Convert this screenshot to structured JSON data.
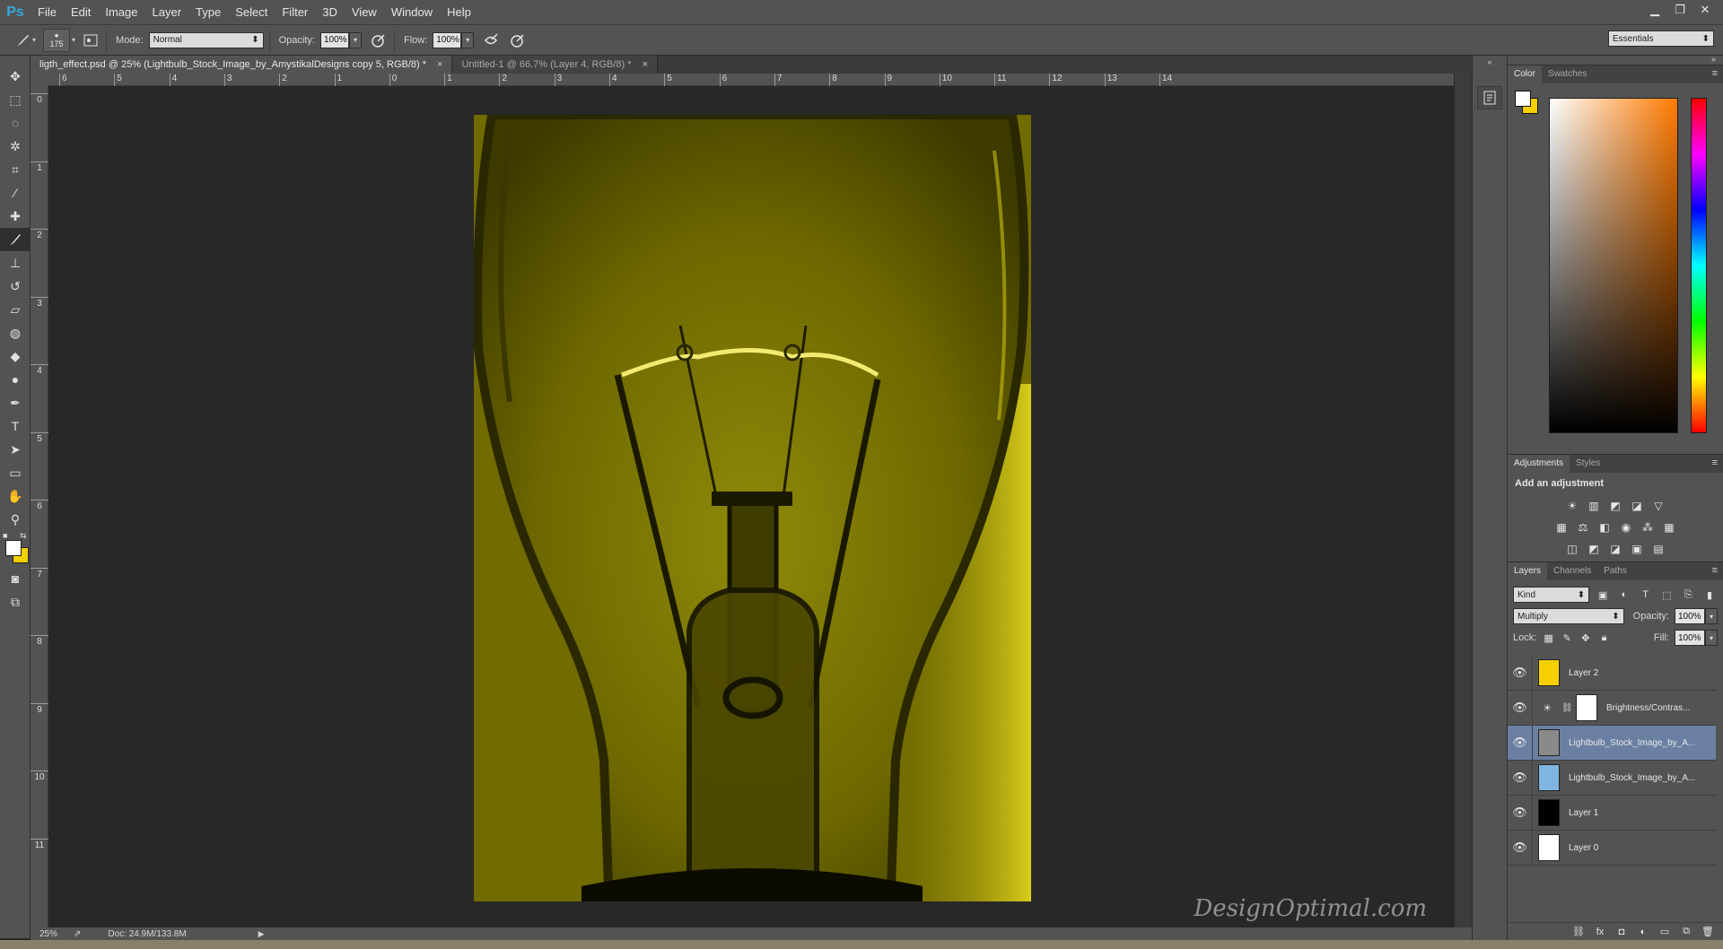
{
  "app": {
    "logo": "Ps"
  },
  "menu": [
    "File",
    "Edit",
    "Image",
    "Layer",
    "Type",
    "Select",
    "Filter",
    "3D",
    "View",
    "Window",
    "Help"
  ],
  "window_controls": {
    "minimize": "▁",
    "restore": "❐",
    "close": "✕"
  },
  "options": {
    "brush_size": "175",
    "mode_label": "Mode:",
    "mode_value": "Normal",
    "opacity_label": "Opacity:",
    "opacity_value": "100%",
    "flow_label": "Flow:",
    "flow_value": "100%",
    "workspace": "Essentials"
  },
  "tabs": [
    {
      "label": "ligth_effect.psd @ 25% (Lightbulb_Stock_Image_by_AmystikalDesigns copy 5, RGB/8) *",
      "active": true
    },
    {
      "label": "Untitled-1 @ 66.7% (Layer 4, RGB/8) *",
      "active": false
    }
  ],
  "tab_close": "×",
  "ruler_h": [
    "6",
    "5",
    "4",
    "3",
    "2",
    "1",
    "0",
    "1",
    "2",
    "3",
    "4",
    "5",
    "6",
    "7",
    "8",
    "9",
    "10",
    "11",
    "12",
    "13",
    "14"
  ],
  "ruler_v": [
    "0",
    "1",
    "2",
    "3",
    "4",
    "5",
    "6",
    "7",
    "8",
    "9",
    "10",
    "11"
  ],
  "status": {
    "zoom": "25%",
    "doc": "Doc: 24.9M/133.8M"
  },
  "watermark": "DesignOptimal.com",
  "color_panel": {
    "tabs": [
      "Color",
      "Swatches"
    ]
  },
  "adjustments_panel": {
    "tabs": [
      "Adjustments",
      "Styles"
    ],
    "title": "Add an adjustment"
  },
  "layers_panel": {
    "tabs": [
      "Layers",
      "Channels",
      "Paths"
    ],
    "filter_kind": "Kind",
    "blend_mode": "Multiply",
    "opacity_label": "Opacity:",
    "opacity_value": "100%",
    "lock_label": "Lock:",
    "fill_label": "Fill:",
    "fill_value": "100%",
    "layers": [
      {
        "name": "Layer 2",
        "thumb_color": "#f5d000",
        "selected": false,
        "adjustment": false
      },
      {
        "name": "Brightness/Contras...",
        "thumb_color": "#ffffff",
        "selected": false,
        "adjustment": true
      },
      {
        "name": "Lightbulb_Stock_Image_by_A...",
        "thumb_color": "#8a8a8a",
        "selected": true,
        "adjustment": false
      },
      {
        "name": "Lightbulb_Stock_Image_by_A...",
        "thumb_color": "#7fb5e0",
        "selected": false,
        "adjustment": false
      },
      {
        "name": "Layer 1",
        "thumb_color": "#000000",
        "selected": false,
        "adjustment": false
      },
      {
        "name": "Layer 0",
        "thumb_color": "#ffffff",
        "selected": false,
        "adjustment": false
      }
    ]
  },
  "colors": {
    "accent_selected": "#6b7fa3",
    "foreground": "#ffffff",
    "background": "#f5d000",
    "image_tint": "#6a6600"
  }
}
